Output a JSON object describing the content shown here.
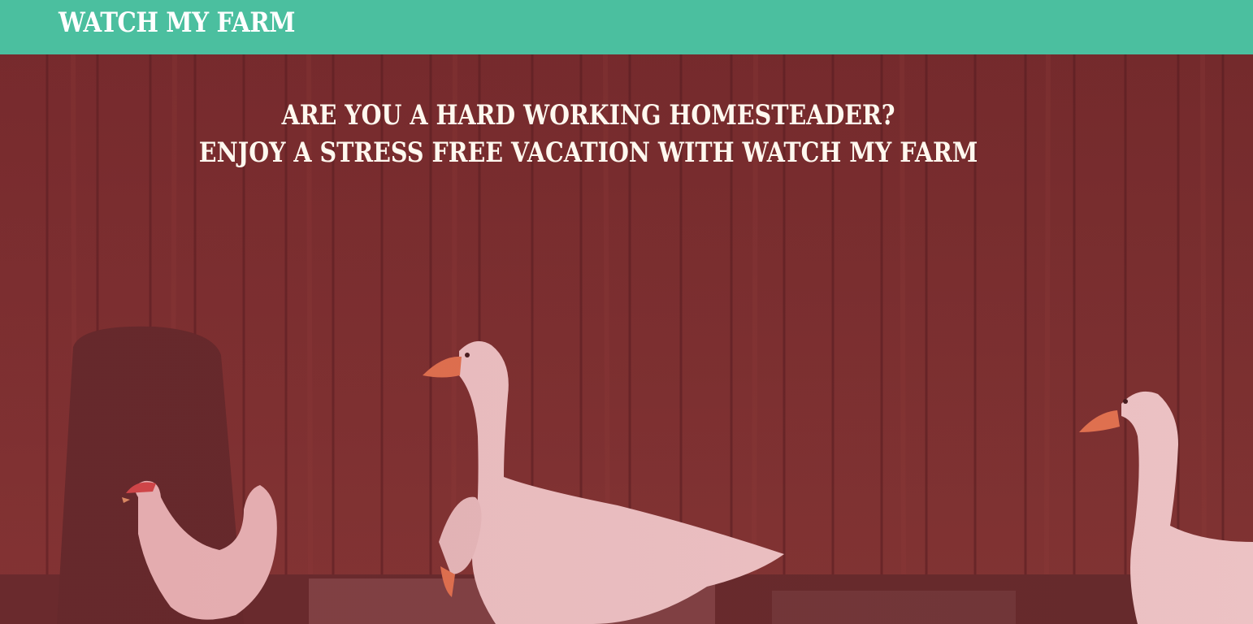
{
  "navbar": {
    "brand": "WATCH MY FARM",
    "background_color": "#4bbf9f"
  },
  "hero": {
    "headline_line1": "ARE YOU A HARD WORKING HOMESTEADER?",
    "headline_line2": "ENJOY A STRESS FREE VACATION WITH WATCH MY FARM",
    "overlay_color": "#a0303a",
    "image_subject": "barn-wall-with-geese-and-chicken"
  }
}
